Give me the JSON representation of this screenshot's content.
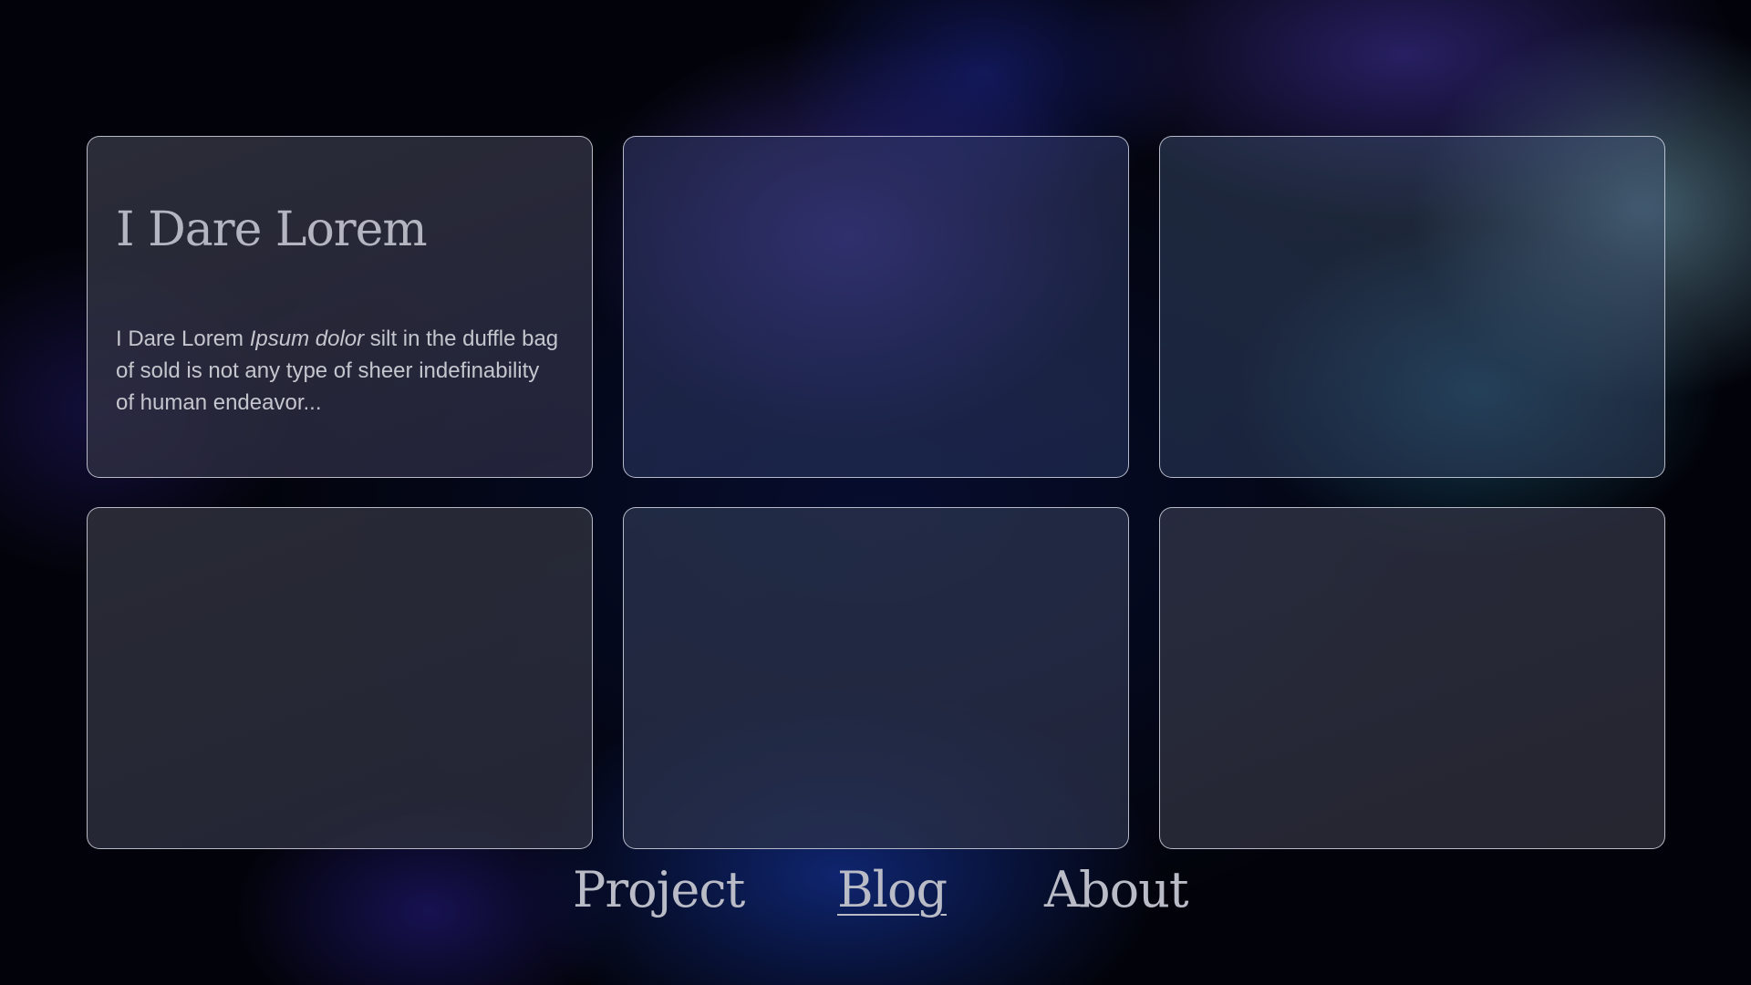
{
  "cards": [
    {
      "title": "I Dare Lorem",
      "body_prefix": "I Dare Lorem ",
      "body_emphasis": "Ipsum dolor",
      "body_suffix": " silt in the duffle bag of sold is not any type of sheer indefinability of human endeavor..."
    },
    {},
    {},
    {},
    {},
    {}
  ],
  "nav": {
    "items": [
      {
        "label": "Project"
      },
      {
        "label": "Blog"
      },
      {
        "label": "About"
      }
    ],
    "active": "Blog"
  }
}
